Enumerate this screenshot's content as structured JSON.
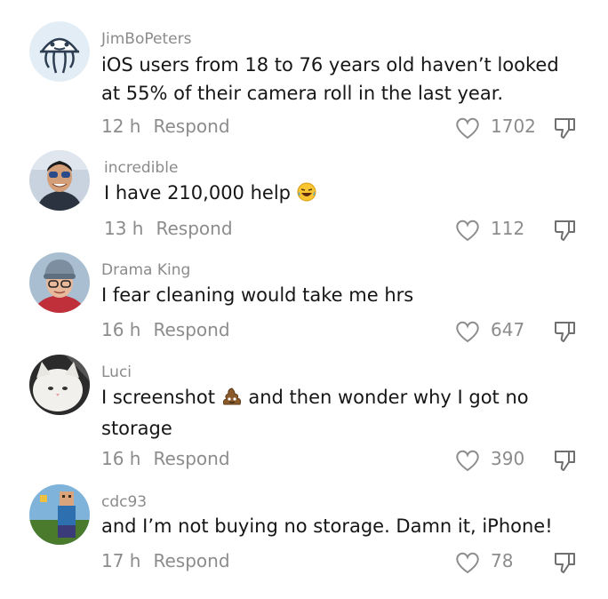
{
  "comments": [
    {
      "user": "JimBoPeters",
      "text": "iOS users from 18 to 76 years old haven’t looked at 55% of their camera roll in the last year.",
      "time": "12 h",
      "respond": "Respond",
      "likes": "1702",
      "avatar_icon": "jellyfish-avatar"
    },
    {
      "user": "incredible",
      "text": "I have 210,000 help",
      "emoji": "laughing-tears-emoji",
      "time": "13 h",
      "respond": "Respond",
      "likes": "112",
      "avatar_icon": "man-sunglasses-avatar"
    },
    {
      "user": "Drama King",
      "text": "I fear cleaning would take me hrs",
      "time": "16 h",
      "respond": "Respond",
      "likes": "647",
      "avatar_icon": "woman-beanie-avatar"
    },
    {
      "user": "Luci",
      "text_before": "I screenshot",
      "text_after": " and then wonder why I got no storage",
      "emoji": "poop-emoji",
      "time": "16 h",
      "respond": "Respond",
      "likes": "390",
      "avatar_icon": "cat-avatar"
    },
    {
      "user": "cdc93",
      "text": "and I’m not buying no storage.  Damn it, iPhone!",
      "time": "17 h",
      "respond": "Respond",
      "likes": "78",
      "avatar_icon": "pixel-character-avatar"
    }
  ]
}
